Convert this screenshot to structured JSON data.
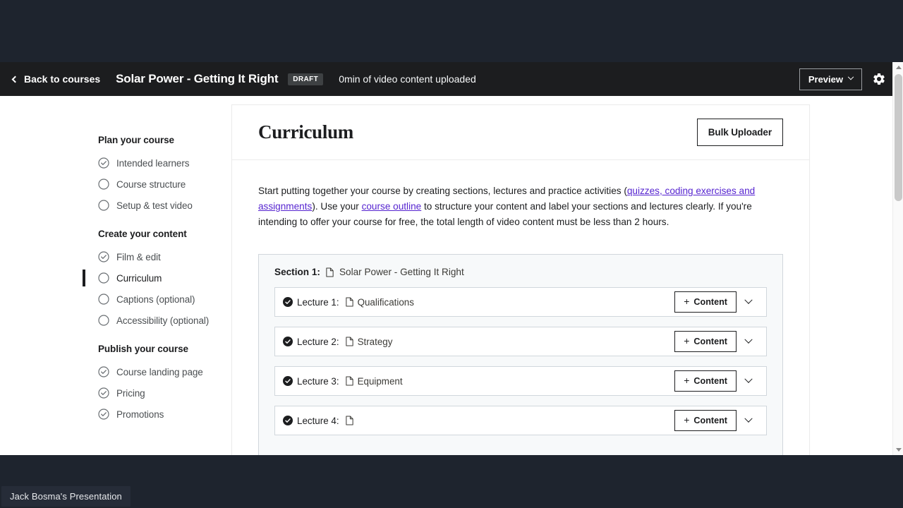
{
  "desktop": {
    "taskbar_item": "Jack Bosma's Presentation"
  },
  "header": {
    "back_label": "Back to courses",
    "course_title": "Solar Power - Getting It Right",
    "status_badge": "DRAFT",
    "upload_status": "0min of video content uploaded",
    "preview_label": "Preview",
    "settings_icon": "gear-icon",
    "back_icon": "chevron-left-icon",
    "background_color": "#1c1d1f"
  },
  "sidebar": {
    "groups": [
      {
        "title": "Plan your course",
        "items": [
          {
            "label": "Intended learners",
            "state": "complete",
            "active": false
          },
          {
            "label": "Course structure",
            "state": "incomplete",
            "active": false
          },
          {
            "label": "Setup & test video",
            "state": "incomplete",
            "active": false
          }
        ]
      },
      {
        "title": "Create your content",
        "items": [
          {
            "label": "Film & edit",
            "state": "complete",
            "active": false
          },
          {
            "label": "Curriculum",
            "state": "incomplete",
            "active": true
          },
          {
            "label": "Captions (optional)",
            "state": "incomplete",
            "active": false
          },
          {
            "label": "Accessibility (optional)",
            "state": "incomplete",
            "active": false
          }
        ]
      },
      {
        "title": "Publish your course",
        "items": [
          {
            "label": "Course landing page",
            "state": "complete",
            "active": false
          },
          {
            "label": "Pricing",
            "state": "complete",
            "active": false
          },
          {
            "label": "Promotions",
            "state": "complete",
            "active": false
          }
        ]
      }
    ]
  },
  "main": {
    "title": "Curriculum",
    "bulk_uploader_label": "Bulk Uploader",
    "intro": {
      "part1": "Start putting together your course by creating sections, lectures and practice activities (",
      "link1": "quizzes, coding exercises and assignments",
      "part2": "). Use your ",
      "link2": "course outline",
      "part3": " to structure your content and label your sections and lectures clearly. If you're intending to offer your course for free, the total length of video content must be less than 2 hours.",
      "link_color": "#5624d0"
    },
    "section": {
      "label": "Section 1:",
      "name": "Solar Power - Getting It Right",
      "doc_icon": "document-icon"
    },
    "lectures": [
      {
        "label": "Lecture 1:",
        "name": "Qualifications",
        "add_label": "Content",
        "state": "complete"
      },
      {
        "label": "Lecture 2:",
        "name": "Strategy",
        "add_label": "Content",
        "state": "complete"
      },
      {
        "label": "Lecture 3:",
        "name": "Equipment",
        "add_label": "Content",
        "state": "complete"
      },
      {
        "label": "Lecture 4:",
        "name": "",
        "add_label": "Content",
        "state": "complete"
      }
    ]
  }
}
